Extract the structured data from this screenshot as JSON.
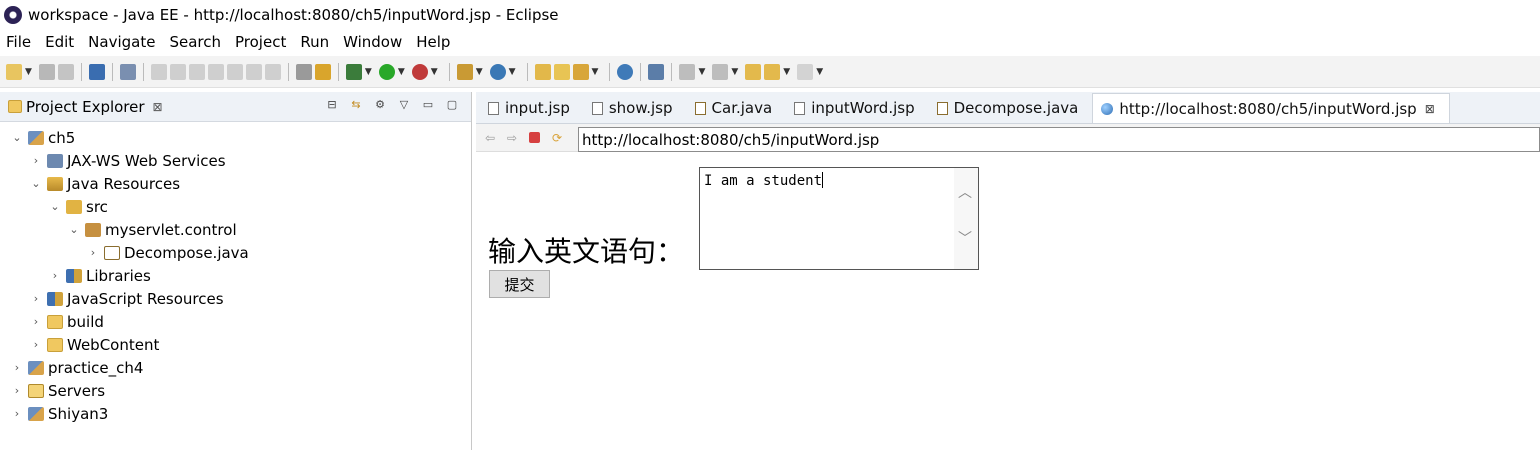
{
  "window": {
    "title": "workspace - Java EE - http://localhost:8080/ch5/inputWord.jsp - Eclipse"
  },
  "menu": [
    {
      "label": "File"
    },
    {
      "label": "Edit"
    },
    {
      "label": "Navigate"
    },
    {
      "label": "Search"
    },
    {
      "label": "Project"
    },
    {
      "label": "Run"
    },
    {
      "label": "Window"
    },
    {
      "label": "Help"
    }
  ],
  "project_explorer": {
    "title": "Project Explorer",
    "close": "⊠",
    "tree": [
      {
        "label": "ch5",
        "depth": 0,
        "expanded": true,
        "icon": "project-icon"
      },
      {
        "label": "JAX-WS Web Services",
        "depth": 1,
        "expanded": false,
        "icon": "webservices-icon"
      },
      {
        "label": "Java Resources",
        "depth": 1,
        "expanded": true,
        "icon": "java-resources-icon"
      },
      {
        "label": "src",
        "depth": 2,
        "expanded": true,
        "icon": "source-folder-icon"
      },
      {
        "label": "myservlet.control",
        "depth": 3,
        "expanded": true,
        "icon": "package-icon"
      },
      {
        "label": "Decompose.java",
        "depth": 4,
        "expanded": false,
        "icon": "java-file-icon"
      },
      {
        "label": "Libraries",
        "depth": 2,
        "expanded": false,
        "icon": "libraries-icon"
      },
      {
        "label": "JavaScript Resources",
        "depth": 1,
        "expanded": false,
        "icon": "javascript-resources-icon"
      },
      {
        "label": "build",
        "depth": 1,
        "expanded": false,
        "icon": "folder-icon"
      },
      {
        "label": "WebContent",
        "depth": 1,
        "expanded": false,
        "icon": "folder-icon"
      },
      {
        "label": "practice_ch4",
        "depth": 0,
        "expanded": false,
        "icon": "project-icon"
      },
      {
        "label": "Servers",
        "depth": 0,
        "expanded": false,
        "icon": "servers-icon"
      },
      {
        "label": "Shiyan3",
        "depth": 0,
        "expanded": false,
        "icon": "project-icon"
      }
    ]
  },
  "editor_tabs": [
    {
      "label": "input.jsp",
      "active": false,
      "icon": "jsp-file-icon"
    },
    {
      "label": "show.jsp",
      "active": false,
      "icon": "jsp-file-icon"
    },
    {
      "label": "Car.java",
      "active": false,
      "icon": "java-file-icon"
    },
    {
      "label": "inputWord.jsp",
      "active": false,
      "icon": "jsp-file-icon"
    },
    {
      "label": "Decompose.java",
      "active": false,
      "icon": "java-file-icon"
    },
    {
      "label": "http://localhost:8080/ch5/inputWord.jsp",
      "active": true,
      "icon": "globe-icon"
    }
  ],
  "browser": {
    "url": "http://localhost:8080/ch5/inputWord.jsp"
  },
  "page": {
    "label": "输入英文语句：",
    "textarea_value": "I am a student",
    "submit_label": "提交"
  }
}
